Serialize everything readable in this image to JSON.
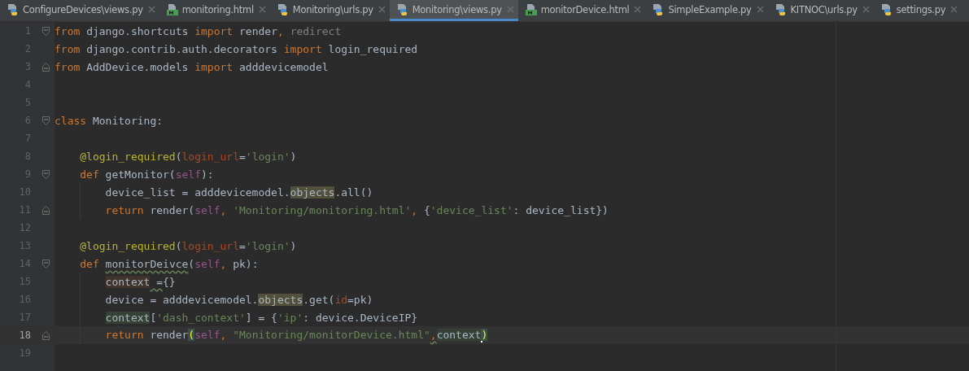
{
  "tabs": [
    {
      "label": "ConfigureDevices\\views.py",
      "kind": "python",
      "selected": false
    },
    {
      "label": "monitoring.html",
      "kind": "html",
      "selected": false
    },
    {
      "label": "Monitoring\\urls.py",
      "kind": "python",
      "selected": false
    },
    {
      "label": "Monitoring\\views.py",
      "kind": "python",
      "selected": true
    },
    {
      "label": "monitorDevice.html",
      "kind": "html",
      "selected": false
    },
    {
      "label": "SimpleExample.py",
      "kind": "python",
      "selected": false
    },
    {
      "label": "KITNOC\\urls.py",
      "kind": "python",
      "selected": false
    },
    {
      "label": "settings.py",
      "kind": "python",
      "selected": false
    }
  ],
  "lines": [
    {
      "number": "1",
      "fold_start": true,
      "current": false,
      "tokens": [
        {
          "text": "from",
          "kind": "keyword"
        },
        {
          "text": " django.shortcuts ",
          "kind": "plain"
        },
        {
          "text": "import",
          "kind": "keyword"
        },
        {
          "text": " render",
          "kind": "plain"
        },
        {
          "text": ", ",
          "kind": "keyword"
        },
        {
          "text": "redirect",
          "kind": "unused"
        }
      ]
    },
    {
      "number": "2",
      "current": false,
      "tokens": [
        {
          "text": "from",
          "kind": "keyword"
        },
        {
          "text": " django.contrib.auth.decorators ",
          "kind": "plain"
        },
        {
          "text": "import",
          "kind": "keyword"
        },
        {
          "text": " login_required",
          "kind": "plain"
        }
      ]
    },
    {
      "number": "3",
      "fold_end": true,
      "current": false,
      "tokens": [
        {
          "text": "from",
          "kind": "keyword"
        },
        {
          "text": " AddDevice.models ",
          "kind": "plain"
        },
        {
          "text": "import",
          "kind": "keyword"
        },
        {
          "text": " adddevicemodel",
          "kind": "plain"
        }
      ]
    },
    {
      "number": "4",
      "current": false
    },
    {
      "number": "5",
      "current": false
    },
    {
      "number": "6",
      "fold_start": true,
      "current": false,
      "tokens": [
        {
          "text": "class",
          "kind": "keyword"
        },
        {
          "text": " Monitoring:",
          "kind": "plain"
        }
      ],
      "children": [
        {
          "number": "7",
          "current": false
        },
        {
          "number": "8",
          "current": false,
          "tokens": [
            {
              "text": "@login_required",
              "kind": "decorator"
            },
            {
              "text": "(",
              "kind": "plain"
            },
            {
              "text": "login_url",
              "kind": "param"
            },
            {
              "text": "=",
              "kind": "plain"
            },
            {
              "text": "'login'",
              "kind": "string"
            },
            {
              "text": ")",
              "kind": "plain"
            }
          ]
        },
        {
          "number": "9",
          "fold_start": true,
          "current": false,
          "tokens": [
            {
              "text": "def",
              "kind": "keyword"
            },
            {
              "text": " getMonitor(",
              "kind": "plain"
            },
            {
              "text": "self",
              "kind": "self"
            },
            {
              "text": "):",
              "kind": "plain"
            }
          ],
          "children": [
            {
              "number": "10",
              "current": false,
              "tokens": [
                {
                  "text": "device_list = adddevicemodel.",
                  "kind": "plain"
                },
                {
                  "text": "objects",
                  "kind": "plain",
                  "usage_highlight": true
                },
                {
                  "text": ".all()",
                  "kind": "plain"
                }
              ]
            },
            {
              "number": "11",
              "fold_end": true,
              "current": false,
              "tokens": [
                {
                  "text": "return",
                  "kind": "keyword"
                },
                {
                  "text": " render(",
                  "kind": "plain"
                },
                {
                  "text": "self",
                  "kind": "self"
                },
                {
                  "text": ", ",
                  "kind": "keyword"
                },
                {
                  "text": "'Monitoring/monitoring.html'",
                  "kind": "string"
                },
                {
                  "text": ", ",
                  "kind": "keyword"
                },
                {
                  "text": "{",
                  "kind": "plain"
                },
                {
                  "text": "'device_list'",
                  "kind": "string"
                },
                {
                  "text": ": device_list})",
                  "kind": "plain"
                }
              ]
            }
          ]
        },
        {
          "number": "12",
          "current": false
        },
        {
          "number": "13",
          "current": false,
          "tokens": [
            {
              "text": "@login_required",
              "kind": "decorator"
            },
            {
              "text": "(",
              "kind": "plain"
            },
            {
              "text": "login_url",
              "kind": "param"
            },
            {
              "text": "=",
              "kind": "plain"
            },
            {
              "text": "'login'",
              "kind": "string"
            },
            {
              "text": ")",
              "kind": "plain"
            }
          ]
        },
        {
          "number": "14",
          "fold_start": true,
          "current": false,
          "tokens": [
            {
              "text": "def ",
              "kind": "keyword"
            },
            {
              "text": "monitorDeivce",
              "kind": "plain",
              "warning": true
            },
            {
              "text": "(",
              "kind": "plain"
            },
            {
              "text": "self",
              "kind": "self"
            },
            {
              "text": ", ",
              "kind": "keyword"
            },
            {
              "text": "pk):",
              "kind": "plain"
            }
          ],
          "children": [
            {
              "number": "15",
              "current": false,
              "tokens": [
                {
                  "text": "context",
                  "kind": "plain",
                  "write_highlight": true
                },
                {
                  "text": " =",
                  "kind": "plain",
                  "warning": true
                },
                {
                  "text": "{}",
                  "kind": "plain"
                }
              ]
            },
            {
              "number": "16",
              "current": false,
              "tokens": [
                {
                  "text": "device = adddevicemodel.",
                  "kind": "plain"
                },
                {
                  "text": "objects",
                  "kind": "plain",
                  "usage_highlight": true
                },
                {
                  "text": ".get(",
                  "kind": "plain"
                },
                {
                  "text": "id",
                  "kind": "param"
                },
                {
                  "text": "=pk)",
                  "kind": "plain"
                }
              ]
            },
            {
              "number": "17",
              "current": false,
              "tokens": [
                {
                  "text": "context",
                  "kind": "plain",
                  "read_highlight": true
                },
                {
                  "text": "[",
                  "kind": "plain"
                },
                {
                  "text": "'dash_context'",
                  "kind": "string"
                },
                {
                  "text": "] = {",
                  "kind": "plain"
                },
                {
                  "text": "'ip'",
                  "kind": "string"
                },
                {
                  "text": ": device.DeviceIP}",
                  "kind": "plain"
                }
              ]
            },
            {
              "number": "18",
              "fold_end": true,
              "current": true,
              "tokens": [
                {
                  "text": "return",
                  "kind": "keyword"
                },
                {
                  "text": " render",
                  "kind": "plain"
                },
                {
                  "text": "(",
                  "kind": "plain",
                  "brace_match": true
                },
                {
                  "text": "self",
                  "kind": "self"
                },
                {
                  "text": ", ",
                  "kind": "keyword"
                },
                {
                  "text": "\"Monitoring/monitorDevice.html\"",
                  "kind": "string"
                },
                {
                  "text": ",",
                  "kind": "keyword",
                  "warning": true
                },
                {
                  "text": "context",
                  "kind": "plain",
                  "read_highlight": true,
                  "caret": true
                },
                {
                  "text": ")",
                  "kind": "plain",
                  "brace_match": true
                }
              ]
            }
          ]
        }
      ]
    },
    {
      "number": "19",
      "current": false
    }
  ]
}
